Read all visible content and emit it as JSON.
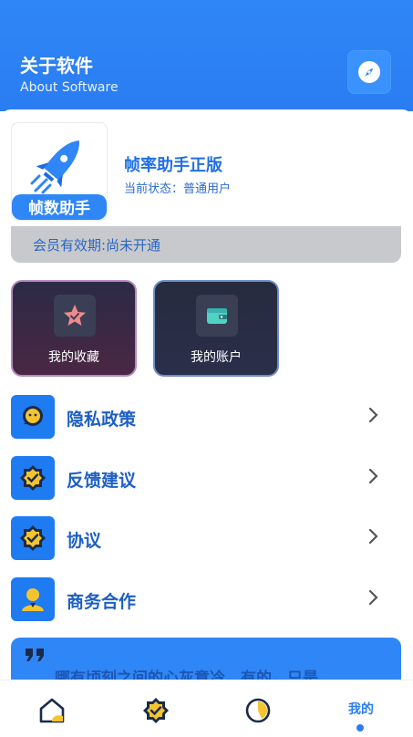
{
  "header": {
    "title": "关于软件",
    "subtitle": "About Software",
    "icon": "compass-icon"
  },
  "app": {
    "logo_text": "帧数助手",
    "name": "帧率助手正版",
    "status": "当前状态：普通用户",
    "membership": "会员有效期:尚未开通"
  },
  "tiles": [
    {
      "label": "我的收藏",
      "icon": "star-icon"
    },
    {
      "label": "我的账户",
      "icon": "wallet-icon"
    }
  ],
  "menu": [
    {
      "label": "隐私政策",
      "icon": "chat-bubble-icon"
    },
    {
      "label": "反馈建议",
      "icon": "badge-check-icon"
    },
    {
      "label": "协议",
      "icon": "badge-check-icon"
    },
    {
      "label": "商务合作",
      "icon": "person-icon"
    }
  ],
  "quote": {
    "text": "哪有顷刻之间的心灰意冷，有的，只是"
  },
  "tabbar": {
    "items": [
      {
        "icon": "home-icon"
      },
      {
        "icon": "badge-check-icon"
      },
      {
        "icon": "pie-chart-icon"
      },
      {
        "label": "我的"
      }
    ],
    "active_index": 3
  },
  "colors": {
    "primary": "#2a7df2",
    "text_blue": "#1e5fc4",
    "tile_dark": "#2b2a45"
  }
}
